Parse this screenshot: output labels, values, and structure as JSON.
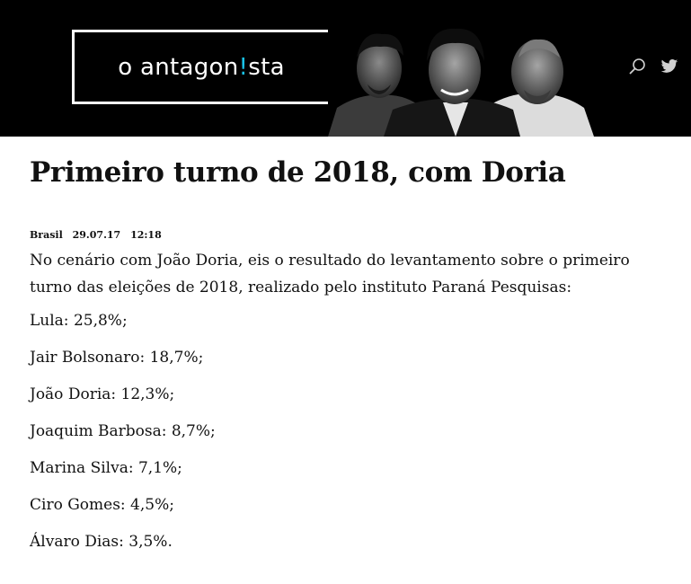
{
  "header": {
    "logo_prefix": "o antagon",
    "logo_accent": "!",
    "logo_suffix": "sta",
    "icons": [
      "search-icon",
      "twitter-icon"
    ],
    "accent_color": "#19c2e6",
    "background_color": "#000000"
  },
  "article": {
    "title": "Primeiro turno de 2018, com Doria",
    "category": "Brasil",
    "date": "29.07.17",
    "time": "12:18",
    "lead": "No cenário com João Doria, eis o resultado do levantamento sobre o primeiro turno das eleições de 2018, realizado pelo instituto Paraná Pesquisas:",
    "results": [
      "Lula: 25,8%;",
      "Jair Bolsonaro: 18,7%;",
      "João Doria: 12,3%;",
      "Joaquim Barbosa: 8,7%;",
      "Marina Silva: 7,1%;",
      "Ciro Gomes: 4,5%;",
      "Álvaro Dias: 3,5%."
    ]
  }
}
